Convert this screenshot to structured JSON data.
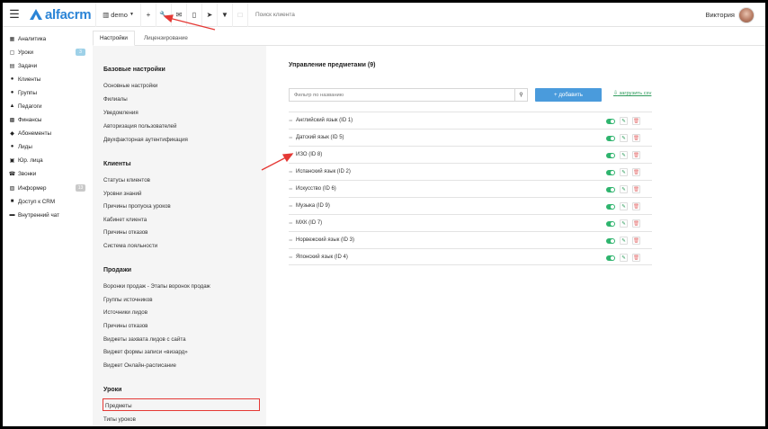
{
  "topbar": {
    "brand": "alfacrm",
    "branch": "demo",
    "search_placeholder": "Поиск клиента",
    "user_name": "Виктория",
    "icons": [
      "menu-icon",
      "building-icon",
      "plus-icon",
      "wrench-icon",
      "mail-icon",
      "phone-icon",
      "send-icon",
      "filter-icon",
      "lock-icon"
    ]
  },
  "sidebar": {
    "items": [
      {
        "label": "Аналитика",
        "icon": "chart-icon"
      },
      {
        "label": "Уроки",
        "icon": "calendar-icon",
        "badge": "3"
      },
      {
        "label": "Задачи",
        "icon": "tasks-icon"
      },
      {
        "label": "Клиенты",
        "icon": "user-icon"
      },
      {
        "label": "Группы",
        "icon": "users-icon"
      },
      {
        "label": "Педагоги",
        "icon": "graduation-cap-icon"
      },
      {
        "label": "Финансы",
        "icon": "money-icon"
      },
      {
        "label": "Абонементы",
        "icon": "tag-icon"
      },
      {
        "label": "Лиды",
        "icon": "user-plus-icon"
      },
      {
        "label": "Юр. лица",
        "icon": "briefcase-icon"
      },
      {
        "label": "Звонки",
        "icon": "phone-icon"
      },
      {
        "label": "Информер",
        "icon": "message-icon",
        "badge": "13"
      },
      {
        "label": "Доступ к CRM",
        "icon": "lock-icon"
      },
      {
        "label": "Внутренний чат",
        "icon": "chat-icon"
      }
    ]
  },
  "tabs": [
    {
      "label": "Настройки",
      "active": true
    },
    {
      "label": "Лицензирование",
      "active": false
    }
  ],
  "settings": {
    "sections": [
      {
        "title": "Базовые настройки",
        "links": [
          "Основные настройки",
          "Филиалы",
          "Уведомления",
          "Авторизация пользователей",
          "Двухфакторная аутентификация"
        ]
      },
      {
        "title": "Клиенты",
        "links": [
          "Статусы клиентов",
          "Уровни знаний",
          "Причины пропуска уроков",
          "Кабинет клиента",
          "Причины отказов",
          "Система лояльности"
        ]
      },
      {
        "title": "Продажи",
        "links": [
          "Воронки продаж - Этапы воронок продаж",
          "Группы источников",
          "Источники лидов",
          "Причины отказов",
          "Виджеты захвата лидов с сайта",
          "Виджет формы записи «визард»",
          "Виджет Онлайн-расписание"
        ]
      },
      {
        "title": "Уроки",
        "links": [
          "Предметы",
          "Типы уроков"
        ]
      }
    ]
  },
  "main": {
    "title": "Управление предметами (9)",
    "filter_placeholder": "Фильтр по названию",
    "add_label": "+ добавить",
    "csv_label": "загрузить csv",
    "subjects": [
      "Английский язык (ID 1)",
      "Датский язык (ID 5)",
      "ИЗО (ID 8)",
      "Испанский язык (ID 2)",
      "Искусство (ID 6)",
      "Музыка (ID 9)",
      "МХК (ID 7)",
      "Норвежский язык (ID 3)",
      "Японский язык (ID 4)"
    ]
  },
  "colors": {
    "brand": "#2b84d6",
    "toggle_on": "#2fb46e",
    "highlight": "#e53935",
    "add_button": "#4a9bdc"
  }
}
